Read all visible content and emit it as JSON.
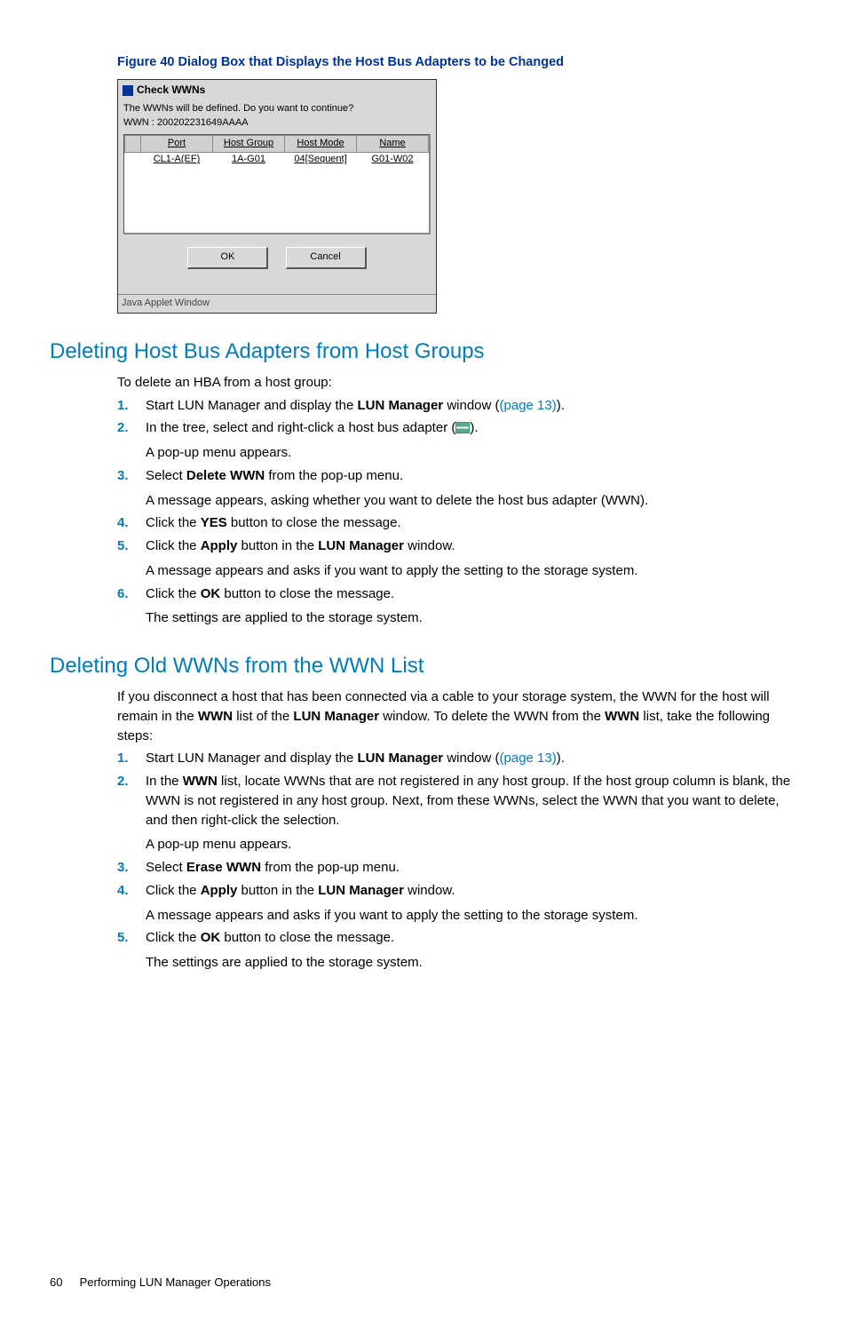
{
  "figure": {
    "caption": "Figure 40 Dialog Box that Displays the Host Bus Adapters to be Changed"
  },
  "dialog": {
    "title": "Check WWNs",
    "msg1": "The WWNs will be defined. Do you want to continue?",
    "msg2": "WWN : 200202231649AAAA",
    "headers": {
      "c1": "Port",
      "c2": "Host Group",
      "c3": "Host Mode",
      "c4": "Name"
    },
    "row": {
      "c1": "CL1-A(EF)",
      "c2": "1A-G01",
      "c3": "04[Sequent]",
      "c4": "G01-W02"
    },
    "ok": "OK",
    "cancel": "Cancel",
    "status": "Java Applet Window"
  },
  "sectionA": {
    "title": "Deleting Host Bus Adapters from Host Groups",
    "intro": "To delete an HBA from a host group:",
    "s1a": "Start LUN Manager and display the ",
    "s1b": "LUN Manager",
    "s1c": " window (",
    "s1link": "(page 13)",
    "s1d": ").",
    "s2a": "In the tree, select and right-click a host bus adapter (",
    "s2b": ").",
    "s2sub": "A pop-up menu appears.",
    "s3a": "Select ",
    "s3b": "Delete WWN",
    "s3c": " from the pop-up menu.",
    "s3sub": "A message appears, asking whether you want to delete the host bus adapter (WWN).",
    "s4a": "Click the ",
    "s4b": "YES",
    "s4c": " button to close the message.",
    "s5a": "Click the ",
    "s5b": "Apply",
    "s5c": " button in the ",
    "s5d": "LUN Manager",
    "s5e": " window.",
    "s5sub": "A message appears and asks if you want to apply the setting to the storage system.",
    "s6a": "Click the ",
    "s6b": "OK",
    "s6c": " button to close the message.",
    "s6sub": "The settings are applied to the storage system."
  },
  "sectionB": {
    "title": "Deleting Old WWNs from the WWN List",
    "p1a": "If you disconnect a host that has been connected via a cable to your storage system, the WWN for the host will remain in the ",
    "p1b": "WWN",
    "p1c": " list of the ",
    "p1d": "LUN Manager",
    "p1e": " window. To delete the WWN from the ",
    "p1f": "WWN",
    "p1g": " list, take the following steps:",
    "s1a": "Start LUN Manager and display the ",
    "s1b": "LUN Manager",
    "s1c": " window (",
    "s1link": "(page 13)",
    "s1d": ").",
    "s2a": "In the ",
    "s2b": "WWN",
    "s2c": " list, locate WWNs that are not registered in any host group. If the host group column is blank, the WWN is not registered in any host group. Next, from these WWNs, select the WWN that you want to delete, and then right-click the selection.",
    "s2sub": "A pop-up menu appears.",
    "s3a": "Select ",
    "s3b": "Erase WWN",
    "s3c": " from the pop-up menu.",
    "s4a": "Click the ",
    "s4b": "Apply",
    "s4c": " button in the ",
    "s4d": "LUN Manager",
    "s4e": " window.",
    "s4sub": "A message appears and asks if you want to apply the setting to the storage system.",
    "s5a": "Click the ",
    "s5b": "OK",
    "s5c": " button to close the message.",
    "s5sub": "The settings are applied to the storage system."
  },
  "footer": {
    "page": "60",
    "title": "Performing LUN Manager Operations"
  }
}
